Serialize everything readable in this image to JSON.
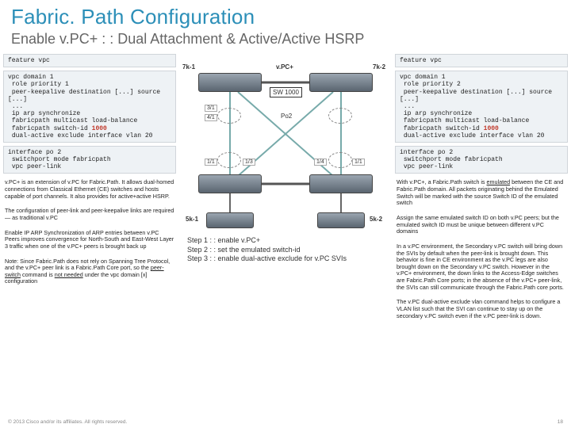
{
  "header": {
    "title": "Fabric. Path Configuration",
    "subtitle": "Enable v.PC+ : : Dual Attachment & Active/Active HSRP"
  },
  "left": {
    "cfg1": "feature vpc",
    "cfg2_l1": "vpc domain 1",
    "cfg2_l2": " role priority 1",
    "cfg2_l3": " peer-keepalive destination [...] source [...]",
    "cfg2_l4": " ...",
    "cfg2_l5": " ip arp synchronize",
    "cfg2_l6": " fabricpath multicast load-balance",
    "cfg2_l7a": " fabricpath switch-id ",
    "cfg2_l7b": "1000",
    "cfg2_l8": " dual-active exclude interface vlan 20",
    "cfg3_l1": "interface po 2",
    "cfg3_l2": " switchport mode fabricpath",
    "cfg3_l3": " vpc peer-link",
    "note1": "v.PC+ is an extension of v.PC for Fabric.Path. It allows dual-homed connections from Classical Ethernet (CE) switches and hosts capable of port channels. It also provides for active+active HSRP.",
    "note2": "The configuration of peer-link and peer-keepalive links are required — as traditional v.PC",
    "note3": "Enable IP ARP Synchronization of ARP entries between v.PC Peers improves convergence for North-South and East-West Layer 3 traffic when one of the v.PC+ peers is brought back up",
    "note4a": "Note:  Since Fabric.Path does not rely on Spanning Tree Protocol, and the v.PC+ peer link is a Fabric.Path Core port, so the ",
    "note4b": "peer-switch",
    "note4c": " command is ",
    "note4d": "not needed",
    "note4e": " under the vpc domain [x] configuration"
  },
  "right": {
    "cfg1": "feature vpc",
    "cfg2_l1": "vpc domain 1",
    "cfg2_l2": " role priority 2",
    "cfg2_l3": " peer-keepalive destination [...] source [...]",
    "cfg2_l4": " ...",
    "cfg2_l5": " ip arp synchronize",
    "cfg2_l6": " fabricpath multicast load-balance",
    "cfg2_l7a": " fabricpath switch-id ",
    "cfg2_l7b": "1000",
    "cfg2_l8": " dual-active exclude interface vlan 20",
    "cfg3_l1": "interface po 2",
    "cfg3_l2": " switchport mode fabricpath",
    "cfg3_l3": " vpc peer-link",
    "rnote1a": "With v.PC+, a Fabric.Path switch is ",
    "rnote1b": "emulated",
    "rnote1c": " between the CE and Fabric.Path domain. All packets originating behind the Emulated Switch will be marked with the source Switch ID of the emulated switch",
    "rnote2": "Assign the same emulated switch ID on both v.PC peers; but the emulated switch ID must be unique between different v.PC domains",
    "rnote3": "In a v.PC environment, the Secondary v.PC switch will bring down the SVIs by default when the peer-link is brought down. This behavior is fine in CE environment as the v.PC legs are also brought down on the Secondary v.PC switch. However in the v.PC+ environment, the down links to the Access-Edge switches are Fabric.Path Core ports; in the absence of the v.PC+ peer-link, the SVIs can still communicate through the Fabric.Path core ports.",
    "rnote4": "The v.PC dual-active exclude vlan command helps to configure a VLAN list such that the SVI can continue to stay up on the secondary v.PC switch even if the v.PC peer-link is down."
  },
  "diagram": {
    "lbl_7k1": "7k-1",
    "lbl_7k2": "7k-2",
    "lbl_vpcplus": "v.PC+",
    "lbl_sw1000": "SW 1000",
    "lbl_po2": "Po2",
    "lbl_5k1": "5k-1",
    "lbl_5k2": "5k-2",
    "port_31": "3/1",
    "port_41": "4/1",
    "port_11a": "1/1",
    "port_13": "1/3",
    "port_14": "1/4",
    "port_11b": "1/1"
  },
  "steps": {
    "s1": "Step 1 : : enable v.PC+",
    "s2": "Step 2 : : set the emulated switch-id",
    "s3": "Step 3 : : enable dual-active exclude for v.PC SVIs"
  },
  "footer": {
    "copyright": "© 2013 Cisco and/or its affiliates. All rights reserved.",
    "page": "18"
  }
}
